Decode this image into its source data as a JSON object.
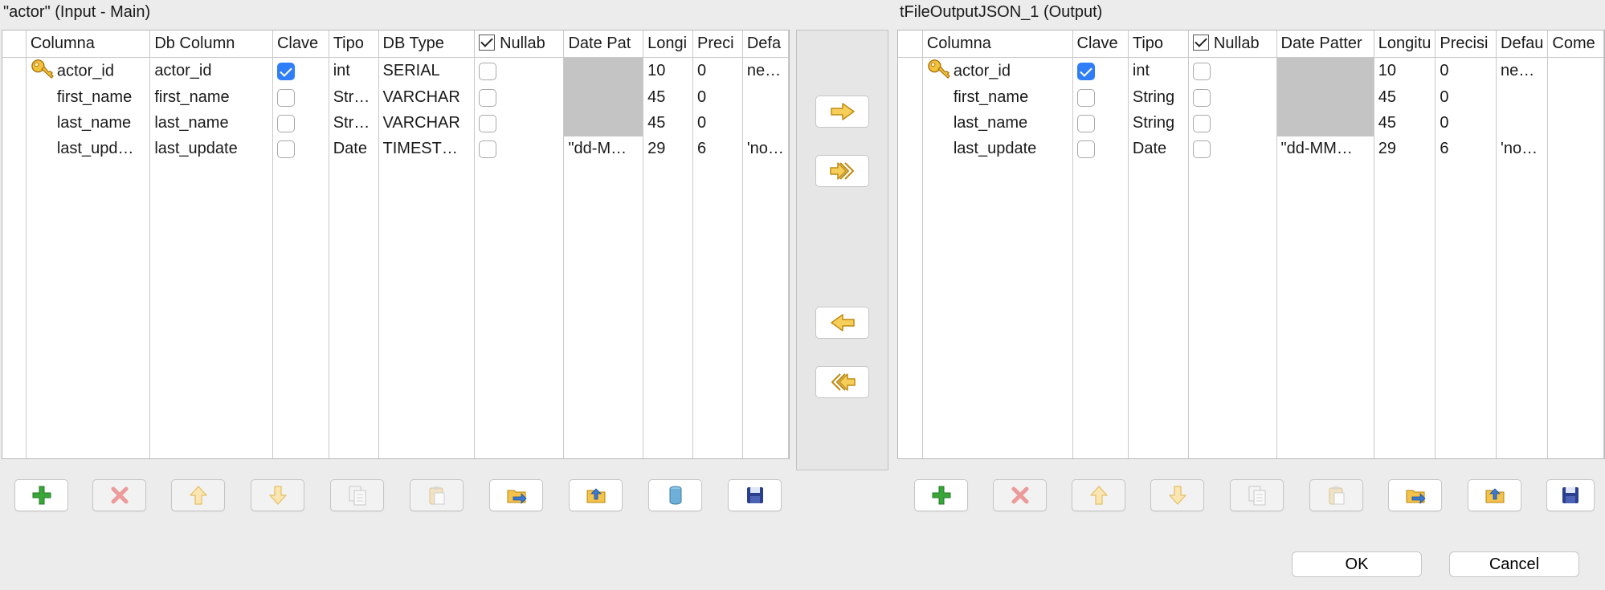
{
  "left": {
    "title": "\"actor\" (Input - Main)",
    "columns": [
      "Columna",
      "Db Column",
      "Clave",
      "Tipo",
      "DB Type",
      "Nullab",
      "Date Pat",
      "Longi",
      "Preci",
      "Defa"
    ],
    "rows": [
      {
        "columna": "actor_id",
        "db_column": "actor_id",
        "clave": true,
        "tipo": "int",
        "db_type": "SERIAL",
        "nullable": false,
        "date_pattern": "",
        "longitud": "10",
        "precision": "0",
        "default": "ne…"
      },
      {
        "columna": "first_name",
        "db_column": "first_name",
        "clave": false,
        "tipo": "Str…",
        "db_type": "VARCHAR",
        "nullable": false,
        "date_pattern": "",
        "longitud": "45",
        "precision": "0",
        "default": ""
      },
      {
        "columna": "last_name",
        "db_column": "last_name",
        "clave": false,
        "tipo": "Str…",
        "db_type": "VARCHAR",
        "nullable": false,
        "date_pattern": "",
        "longitud": "45",
        "precision": "0",
        "default": ""
      },
      {
        "columna": "last_upd…",
        "db_column": "last_update",
        "clave": false,
        "tipo": "Date",
        "db_type": "TIMEST…",
        "nullable": false,
        "date_pattern": "\"dd-M…",
        "longitud": "29",
        "precision": "6",
        "default": "'no…"
      }
    ]
  },
  "right": {
    "title": "tFileOutputJSON_1 (Output)",
    "columns": [
      "Columna",
      "Clave",
      "Tipo",
      "Nullab",
      "Date Patter",
      "Longitu",
      "Precisi",
      "Defau",
      "Come"
    ],
    "rows": [
      {
        "columna": "actor_id",
        "clave": true,
        "tipo": "int",
        "nullable": false,
        "date_pattern": "",
        "longitud": "10",
        "precision": "0",
        "default": "ne…"
      },
      {
        "columna": "first_name",
        "clave": false,
        "tipo": "String",
        "nullable": false,
        "date_pattern": "",
        "longitud": "45",
        "precision": "0",
        "default": ""
      },
      {
        "columna": "last_name",
        "clave": false,
        "tipo": "String",
        "nullable": false,
        "date_pattern": "",
        "longitud": "45",
        "precision": "0",
        "default": ""
      },
      {
        "columna": "last_update",
        "clave": false,
        "tipo": "Date",
        "nullable": false,
        "date_pattern": "\"dd-MM…",
        "longitud": "29",
        "precision": "6",
        "default": "'no…"
      }
    ]
  },
  "toolbar_icons": [
    "add-icon",
    "remove-icon",
    "move-up-icon",
    "move-down-icon",
    "copy-icon",
    "paste-icon",
    "import-icon",
    "export-icon",
    "retrieve-schema-icon",
    "save-icon"
  ],
  "middle_icons": [
    "copy-right-icon",
    "copy-all-right-icon",
    "copy-left-icon",
    "copy-all-left-icon"
  ],
  "buttons": {
    "ok": "OK",
    "cancel": "Cancel"
  },
  "colors": {
    "checkbox_checked": "#2f7ef7",
    "date_pattern_disabled": "#c4c4c4",
    "add_green": "#3aa63a",
    "remove_red": "#e05a5a",
    "save_blue": "#2b3f8f",
    "arrow_yellow": "#f3c64a"
  }
}
